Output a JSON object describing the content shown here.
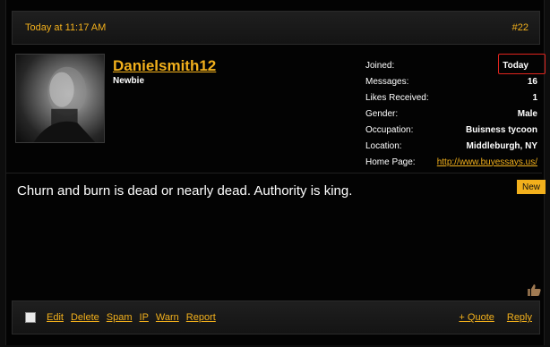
{
  "post": {
    "timestamp": "Today at 11:17 AM",
    "number": "#22"
  },
  "user": {
    "name": "Danielsmith12",
    "title": "Newbie"
  },
  "info": [
    {
      "label": "Joined:",
      "value": "Today"
    },
    {
      "label": "Messages:",
      "value": "16"
    },
    {
      "label": "Likes Received:",
      "value": "1"
    },
    {
      "label": "Gender:",
      "value": "Male"
    },
    {
      "label": "Occupation:",
      "value": "Buisness tycoon"
    },
    {
      "label": "Location:",
      "value": "Middleburgh, NY"
    },
    {
      "label": "Home Page:",
      "value": "http://www.buyessays.us/"
    }
  ],
  "message": "Churn and burn is dead or nearly dead. Authority is king.",
  "badge": "New",
  "footer": {
    "left": [
      "Edit",
      "Delete",
      "Spam",
      "IP",
      "Warn",
      "Report"
    ],
    "quote": "+ Quote",
    "reply": "Reply"
  },
  "colors": {
    "accent": "#f2b01c",
    "highlight_box": "#e0241e"
  }
}
